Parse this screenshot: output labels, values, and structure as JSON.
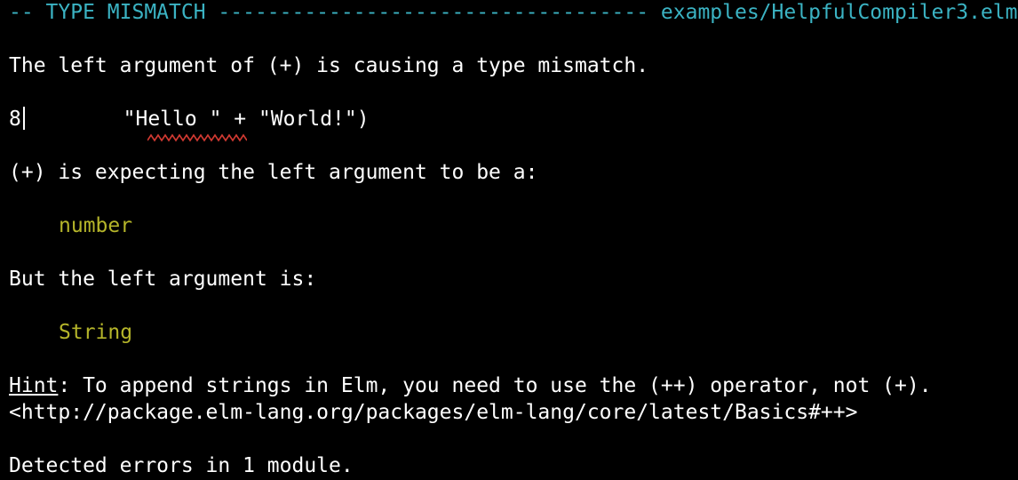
{
  "header": {
    "prefix": "-- TYPE MISMATCH ",
    "dashes": "-----------------------------------",
    "filename": " examples/HelpfulCompiler3.elm"
  },
  "message": {
    "intro": "The left argument of (+) is causing a type mismatch."
  },
  "code": {
    "line_number": "8",
    "source": "        \"Hello \" + \"World!\")"
  },
  "expected": {
    "text": "(+) is expecting the left argument to be a:",
    "type": "number"
  },
  "actual": {
    "text": "But the left argument is:",
    "type": "String"
  },
  "hint": {
    "label": "Hint",
    "text": ": To append strings in Elm, you need to use the (++) operator, not (+).",
    "link": "<http://package.elm-lang.org/packages/elm-lang/core/latest/Basics#++>"
  },
  "footer": {
    "summary": "Detected errors in 1 module."
  },
  "colors": {
    "header": "#3bb3c3",
    "type": "#b5b52a",
    "squiggle": "#d23a32",
    "text": "#ffffff",
    "background": "#000000"
  }
}
